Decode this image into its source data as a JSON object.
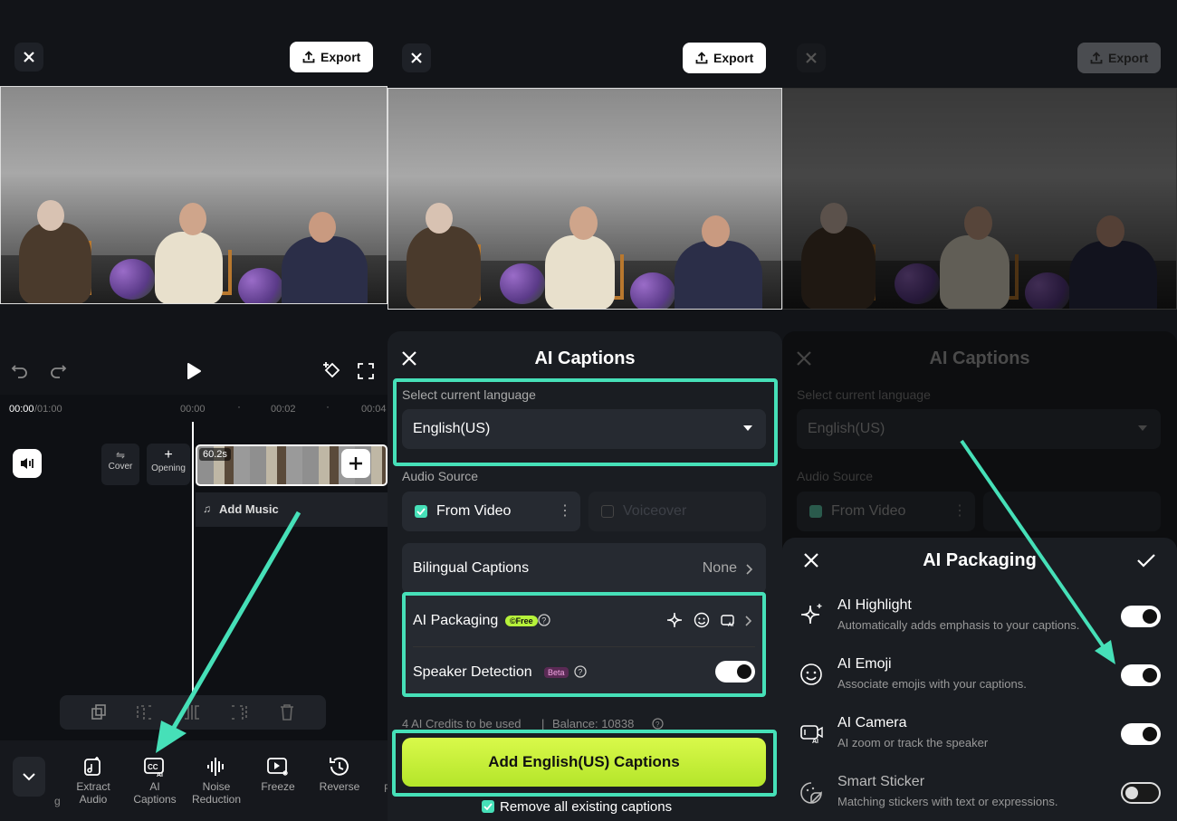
{
  "panel1": {
    "export_label": "Export",
    "time_current": "00:00",
    "time_total": "/01:00",
    "ticks": [
      "00:00",
      "00:02",
      "00:04"
    ],
    "cover_label": "Cover",
    "opening_label": "Opening",
    "clip_duration": "60.2s",
    "add_music": "Add Music",
    "tools": [
      {
        "label": "Extract\nAudio",
        "icon": "extract-audio-icon"
      },
      {
        "label": "AI\nCaptions",
        "icon": "ai-captions-icon"
      },
      {
        "label": "Noise\nReduction",
        "icon": "noise-reduction-icon"
      },
      {
        "label": "Freeze",
        "icon": "freeze-icon"
      },
      {
        "label": "Reverse",
        "icon": "reverse-icon"
      }
    ],
    "partial_left": "g",
    "partial_right": "F"
  },
  "panel2": {
    "export_label": "Export",
    "sheet_title": "AI Captions",
    "lang_label": "Select current language",
    "lang_value": "English(US)",
    "audio_source_label": "Audio Source",
    "from_video": "From Video",
    "voiceover": "Voiceover",
    "bilingual_label": "Bilingual Captions",
    "bilingual_value": "None",
    "packaging_label": "AI Packaging",
    "packaging_badge": "Free",
    "speaker_label": "Speaker Detection",
    "speaker_badge": "Beta",
    "credits_text": "4 AI Credits to be used",
    "balance_text": "Balance: 10838",
    "add_button": "Add English(US) Captions",
    "remove_label": "Remove all existing captions"
  },
  "panel3": {
    "export_label": "Export",
    "sheet_title": "AI Captions",
    "lang_label": "Select current language",
    "lang_value": "English(US)",
    "audio_source_label": "Audio Source",
    "from_video": "From Video",
    "packaging_title": "AI Packaging",
    "items": [
      {
        "title": "AI Highlight",
        "desc": "Automatically adds emphasis to your captions.",
        "on": true
      },
      {
        "title": "AI Emoji",
        "desc": "Associate emojis with your captions.",
        "on": true
      },
      {
        "title": "AI Camera",
        "desc": "AI zoom or track the speaker",
        "on": true
      },
      {
        "title": "Smart Sticker",
        "desc": "Matching stickers with text or expressions.",
        "on": false
      }
    ]
  },
  "colors": {
    "highlight": "#46e0b8",
    "add_button": "#c9f13a",
    "free_badge": "#b6f23a",
    "beta_badge": "#b23fa0"
  }
}
